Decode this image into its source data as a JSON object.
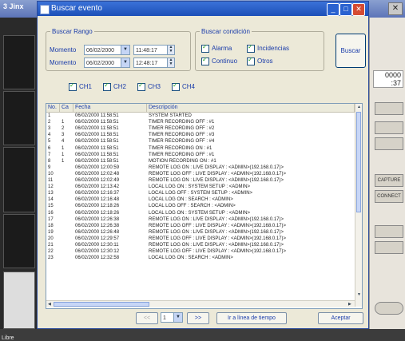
{
  "background": {
    "app_title": "3 Jinx",
    "number_display": "0000\n:37",
    "right_buttons": [
      "",
      "",
      "",
      "CAPTURE",
      "CONNECT",
      "",
      "",
      ""
    ],
    "bottom_label": "Libre"
  },
  "dialog": {
    "title": "Buscar evento",
    "range": {
      "legend": "Buscar Rango",
      "from_label": "Momento",
      "from_date": "06/02/2000",
      "from_time": "11:48:17",
      "to_label": "Momento",
      "to_date": "06/02/2000",
      "to_time": "12:48:17"
    },
    "conditions": {
      "legend": "Buscar condición",
      "items": [
        {
          "label": "Alarma",
          "checked": true
        },
        {
          "label": "Incidencias",
          "checked": true
        },
        {
          "label": "Continuo",
          "checked": true
        },
        {
          "label": "Otros",
          "checked": true
        }
      ]
    },
    "search_button": "Buscar",
    "channels": [
      {
        "label": "CH1",
        "checked": true
      },
      {
        "label": "CH2",
        "checked": true
      },
      {
        "label": "CH3",
        "checked": true
      },
      {
        "label": "CH4",
        "checked": true
      }
    ],
    "table": {
      "columns": [
        "No.",
        "Ca",
        "Fecha",
        "Descripción"
      ],
      "rows": [
        [
          "1",
          "",
          "06/02/2000 11:58:51",
          "SYSTEM STARTED"
        ],
        [
          "2",
          "1",
          "06/02/2000 11:58:51",
          "TIMER RECORDING OFF : #1"
        ],
        [
          "3",
          "2",
          "06/02/2000 11:58:51",
          "TIMER RECORDING OFF : #2"
        ],
        [
          "4",
          "3",
          "06/02/2000 11:58:51",
          "TIMER RECORDING OFF : #3"
        ],
        [
          "5",
          "4",
          "06/02/2000 11:58:51",
          "TIMER RECORDING OFF : #4"
        ],
        [
          "6",
          "1",
          "06/02/2000 11:58:51",
          "TIMER RECORDING ON : #1"
        ],
        [
          "7",
          "1",
          "06/02/2000 11:58:51",
          "TIMER RECORDING OFF : #1"
        ],
        [
          "8",
          "1",
          "06/02/2000 11:58:51",
          "MOTION RECORDING ON : #1"
        ],
        [
          "9",
          "",
          "06/02/2000 12:00:59",
          "REMOTE LOG ON : LIVE DISPLAY : <ADMIN>(192.168.0.17)>"
        ],
        [
          "10",
          "",
          "06/02/2000 12:02:48",
          "REMOTE LOG OFF : LIVE DISPLAY : <ADMIN>(192.168.0.17)>"
        ],
        [
          "11",
          "",
          "06/02/2000 12:02:49",
          "REMOTE LOG ON : LIVE DISPLAY : <ADMIN>(192.168.0.17)>"
        ],
        [
          "12",
          "",
          "06/02/2000 12:13:42",
          "LOCAL LOG ON : SYSTEM SETUP : <ADMIN>"
        ],
        [
          "13",
          "",
          "06/02/2000 12:16:37",
          "LOCAL LOG OFF : SYSTEM SETUP : <ADMIN>"
        ],
        [
          "14",
          "",
          "06/02/2000 12:16:48",
          "LOCAL LOG ON : SEARCH : <ADMIN>"
        ],
        [
          "15",
          "",
          "06/02/2000 12:18:26",
          "LOCAL LOG OFF : SEARCH : <ADMIN>"
        ],
        [
          "16",
          "",
          "06/02/2000 12:18:26",
          "LOCAL LOG ON : SYSTEM SETUP : <ADMIN>"
        ],
        [
          "17",
          "",
          "06/02/2000 12:26:38",
          "REMOTE LOG ON : LIVE DISPLAY : <ADMIN>(192.168.0.17)>"
        ],
        [
          "18",
          "",
          "06/02/2000 12:26:38",
          "REMOTE LOG OFF : LIVE DISPLAY : <ADMIN>(192.168.0.17)>"
        ],
        [
          "19",
          "",
          "06/02/2000 12:26:48",
          "REMOTE LOG ON : LIVE DISPLAY : <ADMIN>(192.168.0.17)>"
        ],
        [
          "20",
          "",
          "06/02/2000 12:29:57",
          "REMOTE LOG OFF : LIVE DISPLAY : <ADMIN>(192.168.0.17)>"
        ],
        [
          "21",
          "",
          "06/02/2000 12:30:11",
          "REMOTE LOG ON : LIVE DISPLAY : <ADMIN>(192.168.0.17)>"
        ],
        [
          "22",
          "",
          "06/02/2000 12:30:12",
          "REMOTE LOG OFF : LIVE DISPLAY : <ADMIN>(192.168.0.17)>"
        ],
        [
          "23",
          "",
          "06/02/2000 12:32:58",
          "LOCAL LOG ON : SEARCH : <ADMIN>"
        ]
      ]
    },
    "pagination": {
      "prev_label": "<<",
      "page_value": "1",
      "next_label": ">>",
      "goto_label": "Ir a línea de tiempo"
    },
    "accept_button": "Aceptar"
  },
  "colors": {
    "titlebar": "#1c4fb8",
    "label_blue": "#1a3caa",
    "check_green": "#21a121",
    "dialog_bg": "#ece9d8"
  }
}
